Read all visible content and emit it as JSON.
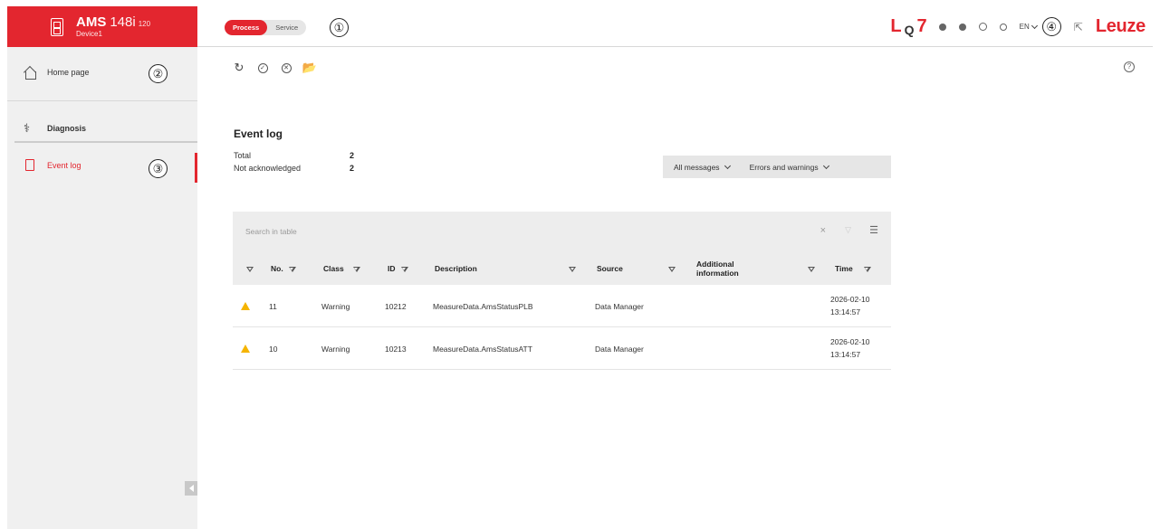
{
  "brand": {
    "product": "AMS",
    "model": "148i",
    "variant": "120",
    "device": "Device1"
  },
  "header": {
    "modes": [
      "Process",
      "Service"
    ],
    "active_mode": "Process",
    "language": "EN",
    "logo": "Leuze",
    "icons": [
      "lq-search-icon",
      "status-icon",
      "notification-icon",
      "user-icon",
      "settings-icon",
      "language-chevron-icon",
      "cursor-icon"
    ]
  },
  "callouts": {
    "c1": "①",
    "c2": "②",
    "c3": "③",
    "c4": "④"
  },
  "sidebar": {
    "home": "Home page",
    "section": "Diagnosis",
    "items": [
      {
        "label": "Event log",
        "active": true
      }
    ]
  },
  "toolbar": {
    "icons": [
      "refresh-icon",
      "acknowledge-icon",
      "delete-icon",
      "export-icon"
    ]
  },
  "main": {
    "title": "Event log",
    "stats": [
      {
        "label": "Total",
        "value": "2"
      },
      {
        "label": "Not acknowledged",
        "value": "2"
      }
    ],
    "filters": {
      "messages": "All messages",
      "severity": "Errors and warnings"
    }
  },
  "table": {
    "search_placeholder": "Search in table",
    "columns": {
      "no": "No.",
      "class": "Class",
      "id": "ID",
      "description": "Description",
      "source": "Source",
      "additional": "Additional information",
      "time": "Time"
    },
    "rows": [
      {
        "no": "11",
        "class": "Warning",
        "id": "10212",
        "description": "MeasureData.AmsStatusPLB",
        "source": "Data Manager",
        "additional": "",
        "date": "2026-02-10",
        "time": "13:14:57"
      },
      {
        "no": "10",
        "class": "Warning",
        "id": "10213",
        "description": "MeasureData.AmsStatusATT",
        "source": "Data Manager",
        "additional": "",
        "date": "2026-02-10",
        "time": "13:14:57"
      }
    ]
  },
  "colors": {
    "accent": "#e3262f",
    "warning": "#f5b400",
    "sidebar": "#f0f0f0"
  }
}
